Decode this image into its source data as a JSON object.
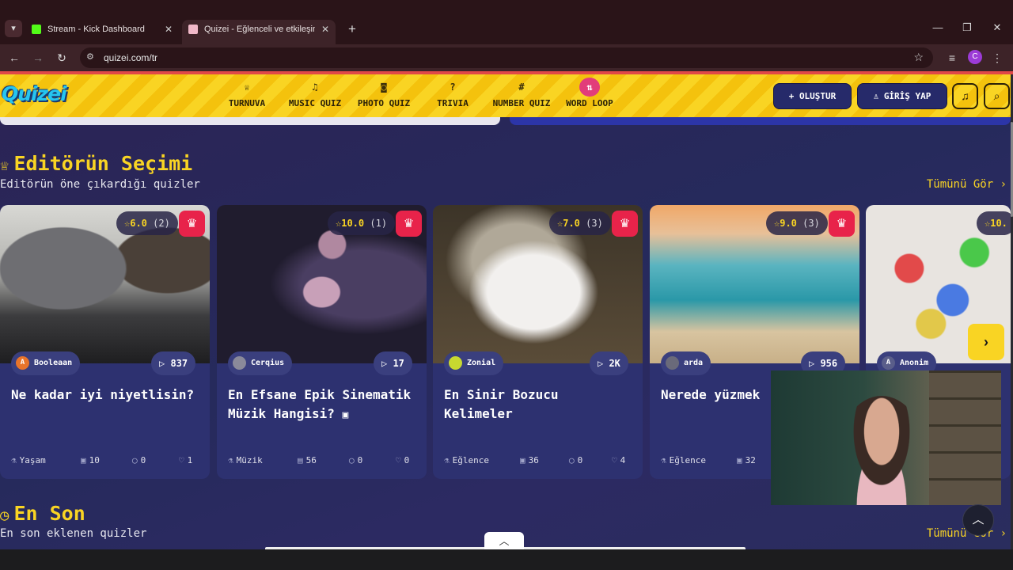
{
  "browser": {
    "tabs": [
      {
        "title": "Stream - Kick Dashboard",
        "favicon_color": "#53fc18"
      },
      {
        "title": "Quizei - Eğlenceli ve etkileşimli",
        "favicon_color": "#f0b8c8"
      }
    ],
    "url": "quizei.com/tr",
    "profile_initial": "C"
  },
  "site": {
    "logo": "Quizei",
    "nav": [
      {
        "label": "TURNUVA",
        "icon": "trophy-icon",
        "glyph": "♕"
      },
      {
        "label": "MUSIC QUIZ",
        "icon": "music-note-icon",
        "glyph": "♫"
      },
      {
        "label": "PHOTO QUIZ",
        "icon": "camera-icon",
        "glyph": "◙"
      },
      {
        "label": "TRIVIA",
        "icon": "question-bubble-icon",
        "glyph": "?"
      },
      {
        "label": "NUMBER QUIZ",
        "icon": "hash-icon",
        "glyph": "#"
      },
      {
        "label": "WORD LOOP",
        "icon": "sort-icon",
        "glyph": "⇅"
      }
    ],
    "create_label": "OLUŞTUR",
    "login_label": "GİRİŞ YAP"
  },
  "editors_pick": {
    "title": "Editörün Seçimi",
    "subtitle": "Editörün öne çıkardığı quizler",
    "see_all": "Tümünü Gör",
    "cards": [
      {
        "rating": "6.0",
        "count": "(2)",
        "author": "Booleaan",
        "author_initial": "A",
        "avatar_color": "#e8742a",
        "plays": "837",
        "title": "Ne kadar iyi niyetlisin?",
        "category": "Yaşam",
        "questions": "10",
        "comments": "0",
        "likes": "1"
      },
      {
        "rating": "10.0",
        "count": "(1)",
        "author": "Cerqius",
        "author_initial": "",
        "avatar_color": "#8a8a9a",
        "plays": "17",
        "title": "En Efsane Epik Sinematik Müzik Hangisi?",
        "category": "Müzik",
        "questions": "56",
        "comments": "0",
        "likes": "0"
      },
      {
        "rating": "7.0",
        "count": "(3)",
        "author": "Zonial",
        "author_initial": "",
        "avatar_color": "#c8d830",
        "plays": "2K",
        "title": "En Sinir Bozucu Kelimeler",
        "category": "Eğlence",
        "questions": "36",
        "comments": "0",
        "likes": "4"
      },
      {
        "rating": "9.0",
        "count": "(3)",
        "author": "arda",
        "author_initial": "",
        "avatar_color": "#6a6a7a",
        "plays": "956",
        "title": "Nerede yüzmek",
        "category": "Eğlence",
        "questions": "32",
        "comments": "",
        "likes": ""
      },
      {
        "rating": "10.",
        "count": "",
        "author": "Anonim",
        "author_initial": "A",
        "avatar_color": "#5a5e8a",
        "plays": "",
        "title": "",
        "category": "",
        "questions": "",
        "comments": "",
        "likes": ""
      }
    ]
  },
  "latest": {
    "title": "En Son",
    "subtitle": "En son eklenen quizler",
    "see_all": "Tümünü Gör"
  },
  "colors": {
    "accent": "#f9d423",
    "card_bg": "#2d3170",
    "crown_red": "#e8234a",
    "header_btn": "#262a6a"
  }
}
